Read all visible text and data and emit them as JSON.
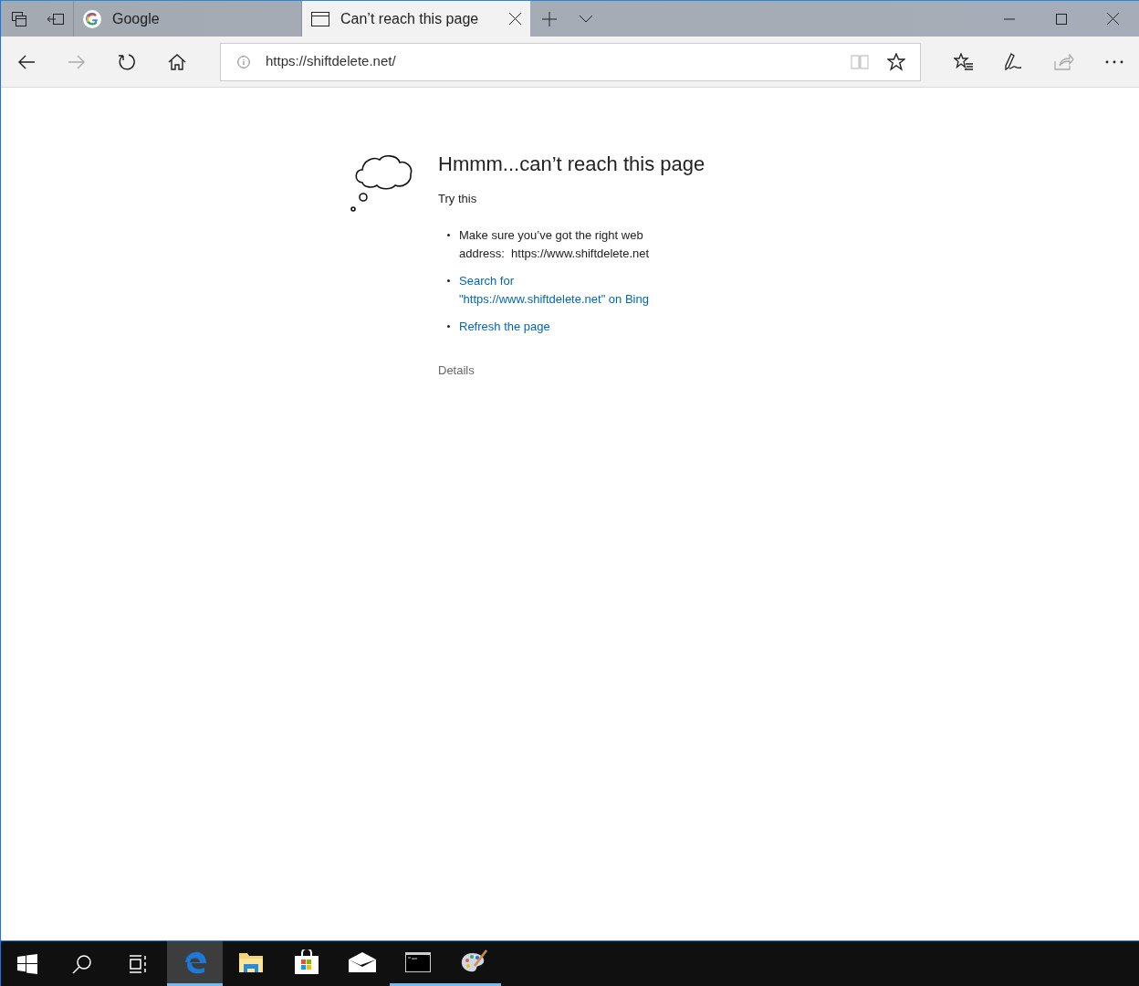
{
  "tabs": [
    {
      "label": "Google",
      "kind": "google",
      "selected": false
    },
    {
      "label": "Can’t reach this page",
      "kind": "page",
      "selected": true
    }
  ],
  "address_bar": {
    "value": "https://shiftdelete.net/"
  },
  "error_page": {
    "heading": "Hmmm...can’t reach this page",
    "subheading": "Try this",
    "suggestions": [
      {
        "kind": "text",
        "lines": [
          "Make sure you’ve got the right web",
          "address:  https://www.shiftdelete.net"
        ]
      },
      {
        "kind": "link",
        "lines": [
          "Search for",
          "\"https://www.shiftdelete.net\" on Bing"
        ]
      },
      {
        "kind": "link",
        "lines": [
          "Refresh the page"
        ]
      }
    ],
    "details": "Details"
  },
  "taskbar": [
    {
      "kind": "edge",
      "active": true,
      "running": true
    },
    {
      "kind": "folder",
      "active": false,
      "running": false
    },
    {
      "kind": "store",
      "active": false,
      "running": false
    },
    {
      "kind": "mail",
      "active": false,
      "running": false
    },
    {
      "kind": "terminal",
      "active": false,
      "running": true
    },
    {
      "kind": "paint",
      "active": false,
      "running": true
    }
  ]
}
